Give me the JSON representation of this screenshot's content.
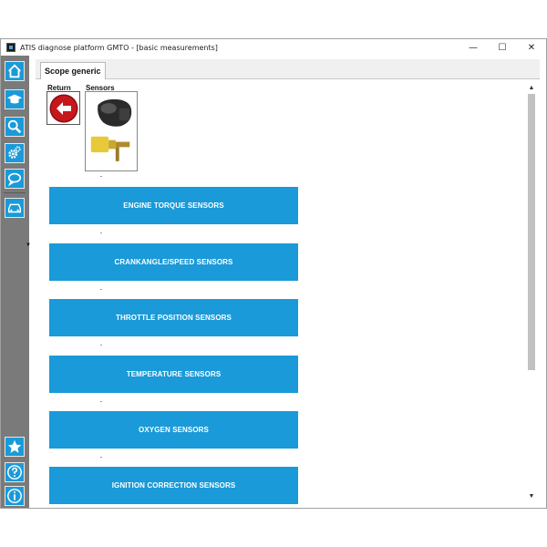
{
  "window": {
    "title": "ATIS diagnose platform GMTO - [basic measurements]",
    "minimize_symbol": "—",
    "maximize_symbol": "☐",
    "close_symbol": "✕"
  },
  "sidebar": {
    "items": [
      {
        "name": "home-icon"
      },
      {
        "name": "graduation-cap-icon"
      },
      {
        "name": "search-icon"
      },
      {
        "name": "gear-icon"
      },
      {
        "name": "speech-bubble-icon"
      },
      {
        "name": "car-icon"
      },
      {
        "name": "star-icon"
      },
      {
        "name": "help-icon"
      },
      {
        "name": "info-icon"
      }
    ]
  },
  "tab": {
    "label": "Scope generic"
  },
  "nav": {
    "return_label": "Return",
    "sensors_label": "Sensors"
  },
  "categories": [
    "ENGINE TORQUE SENSORS",
    "CRANKANGLE/SPEED SENSORS",
    "THROTTLE POSITION SENSORS",
    "TEMPERATURE SENSORS",
    "OXYGEN SENSORS",
    "IGNITION CORRECTION SENSORS"
  ],
  "colors": {
    "accent": "#1a9ad8",
    "sidebar": "#7a7a7a",
    "return_red": "#c8161d"
  }
}
